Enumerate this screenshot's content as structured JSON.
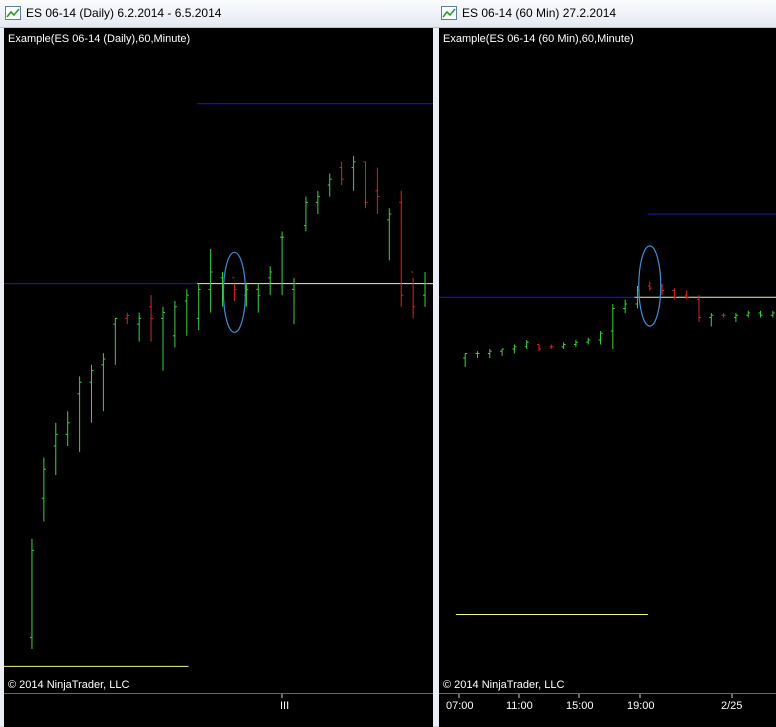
{
  "windows": [
    {
      "id": "daily",
      "title": "ES 06-14 (Daily)  6.2.2014 - 6.5.2014",
      "chart_label": "Example(ES 06-14 (Daily),60,Minute)",
      "copyright": "© 2014 NinjaTrader, LLC",
      "x_axis_labels": [
        "III"
      ]
    },
    {
      "id": "60min",
      "title": "ES 06-14 (60 Min)  27.2.2014",
      "chart_label": "Example(ES 06-14 (60 Min),60,Minute)",
      "copyright": "© 2014 NinjaTrader, LLC",
      "x_axis_labels": [
        "07:00",
        "11:00",
        "15:00",
        "19:00",
        "2/25"
      ]
    }
  ],
  "colors": {
    "up_bar": "#3dd13d",
    "down_bar": "#e02020",
    "level_line_blue": "#1a1acc",
    "level_line_yellow": "#f2f28c",
    "highlight_ellipse": "#3a8fd8",
    "background": "#000000",
    "text": "#ffffff"
  },
  "chart_data": [
    {
      "type": "ohlc",
      "name": "ES 06-14 (Daily)",
      "y_range": [
        0,
        100
      ],
      "bars": [
        {
          "o": 7,
          "h": 24,
          "l": 5,
          "c": 22,
          "dir": "up"
        },
        {
          "o": 31,
          "h": 38,
          "l": 27,
          "c": 36,
          "dir": "up"
        },
        {
          "o": 40,
          "h": 44,
          "l": 35,
          "c": 42,
          "dir": "up"
        },
        {
          "o": 42,
          "h": 46,
          "l": 40,
          "c": 44,
          "dir": "up"
        },
        {
          "o": 49,
          "h": 52,
          "l": 39,
          "c": 51,
          "dir": "up"
        },
        {
          "o": 51,
          "h": 54,
          "l": 44,
          "c": 53,
          "dir": "up"
        },
        {
          "o": 54,
          "h": 56,
          "l": 46,
          "c": 55,
          "dir": "up"
        },
        {
          "o": 61,
          "h": 62,
          "l": 54,
          "c": 62,
          "dir": "up"
        },
        {
          "o": 62,
          "h": 63,
          "l": 61,
          "c": 62.5,
          "dir": "down"
        },
        {
          "o": 61,
          "h": 63,
          "l": 58,
          "c": 62,
          "dir": "up"
        },
        {
          "o": 64,
          "h": 66,
          "l": 58,
          "c": 62,
          "dir": "down"
        },
        {
          "o": 62,
          "h": 64,
          "l": 53,
          "c": 63,
          "dir": "up"
        },
        {
          "o": 59,
          "h": 65,
          "l": 57,
          "c": 64,
          "dir": "up"
        },
        {
          "o": 65,
          "h": 67,
          "l": 59,
          "c": 66,
          "dir": "up"
        },
        {
          "o": 62,
          "h": 68,
          "l": 60,
          "c": 67,
          "dir": "up"
        },
        {
          "o": 67,
          "h": 74,
          "l": 63,
          "c": 70,
          "dir": "up"
        },
        {
          "o": 69,
          "h": 70,
          "l": 64,
          "c": 68,
          "dir": "up"
        },
        {
          "o": 69,
          "h": 68,
          "l": 65,
          "c": 67,
          "dir": "down"
        },
        {
          "o": 66,
          "h": 68,
          "l": 64,
          "c": 67,
          "dir": "up"
        },
        {
          "o": 67,
          "h": 68,
          "l": 63,
          "c": 66,
          "dir": "up"
        },
        {
          "o": 69,
          "h": 71,
          "l": 66,
          "c": 70,
          "dir": "up"
        },
        {
          "o": 76,
          "h": 77,
          "l": 66,
          "c": 76,
          "dir": "up"
        },
        {
          "o": 67,
          "h": 69,
          "l": 61,
          "c": 68,
          "dir": "up"
        },
        {
          "o": 78,
          "h": 83,
          "l": 77,
          "c": 82,
          "dir": "up"
        },
        {
          "o": 82,
          "h": 84,
          "l": 80,
          "c": 83,
          "dir": "up"
        },
        {
          "o": 85,
          "h": 87,
          "l": 83,
          "c": 86,
          "dir": "up"
        },
        {
          "o": 88,
          "h": 89,
          "l": 85,
          "c": 86,
          "dir": "down"
        },
        {
          "o": 88,
          "h": 90,
          "l": 84,
          "c": 89,
          "dir": "up"
        },
        {
          "o": 89,
          "h": 89,
          "l": 81,
          "c": 82,
          "dir": "down"
        },
        {
          "o": 84,
          "h": 88,
          "l": 80,
          "c": 83,
          "dir": "down"
        },
        {
          "o": 79,
          "h": 81,
          "l": 72,
          "c": 80,
          "dir": "up"
        },
        {
          "o": 82,
          "h": 84,
          "l": 64,
          "c": 66,
          "dir": "down"
        },
        {
          "o": 70,
          "h": 69,
          "l": 62,
          "c": 64,
          "dir": "down"
        },
        {
          "o": 66,
          "h": 70,
          "l": 64,
          "c": 68,
          "dir": "up"
        }
      ],
      "levels": [
        {
          "color": "blue",
          "value": 68,
          "from": 0,
          "to": 0.45
        },
        {
          "color": "yellow",
          "value": 68,
          "from": 0.45,
          "to": 1.0
        },
        {
          "color": "blue",
          "value": 99,
          "from": 0.45,
          "to": 1.0
        },
        {
          "color": "yellow",
          "value": 2,
          "from": 0,
          "to": 0.43
        }
      ],
      "highlight": {
        "bar_index": 17
      }
    },
    {
      "type": "ohlc",
      "name": "ES 06-14 (60 Min)",
      "y_range": [
        0,
        100
      ],
      "bars": [
        {
          "o": 60,
          "h": 61,
          "l": 58,
          "c": 61,
          "dir": "up"
        },
        {
          "o": 61,
          "h": 61.5,
          "l": 60,
          "c": 61,
          "dir": "up"
        },
        {
          "o": 61,
          "h": 62,
          "l": 60,
          "c": 61.5,
          "dir": "up"
        },
        {
          "o": 61.5,
          "h": 62,
          "l": 60.5,
          "c": 62,
          "dir": "up"
        },
        {
          "o": 62,
          "h": 63,
          "l": 61,
          "c": 62.5,
          "dir": "up"
        },
        {
          "o": 62.5,
          "h": 64,
          "l": 62,
          "c": 63.5,
          "dir": "up"
        },
        {
          "o": 63,
          "h": 63,
          "l": 61.5,
          "c": 62,
          "dir": "down"
        },
        {
          "o": 62.5,
          "h": 63,
          "l": 62,
          "c": 62.5,
          "dir": "down"
        },
        {
          "o": 62.5,
          "h": 63.5,
          "l": 62,
          "c": 63,
          "dir": "up"
        },
        {
          "o": 63,
          "h": 64,
          "l": 62.5,
          "c": 63.5,
          "dir": "up"
        },
        {
          "o": 63.5,
          "h": 64.5,
          "l": 63,
          "c": 64,
          "dir": "up"
        },
        {
          "o": 64,
          "h": 66,
          "l": 63,
          "c": 65.5,
          "dir": "up"
        },
        {
          "o": 66,
          "h": 72,
          "l": 62,
          "c": 71,
          "dir": "up"
        },
        {
          "o": 71,
          "h": 73,
          "l": 70,
          "c": 72,
          "dir": "up"
        },
        {
          "o": 72,
          "h": 76,
          "l": 71,
          "c": 75,
          "dir": "up"
        },
        {
          "o": 76,
          "h": 77,
          "l": 75,
          "c": 75.5,
          "dir": "down"
        },
        {
          "o": 76,
          "h": 76.5,
          "l": 74,
          "c": 75,
          "dir": "down"
        },
        {
          "o": 75,
          "h": 75.5,
          "l": 73,
          "c": 73.5,
          "dir": "down"
        },
        {
          "o": 74,
          "h": 75,
          "l": 73,
          "c": 73.5,
          "dir": "down"
        },
        {
          "o": 73,
          "h": 74,
          "l": 68,
          "c": 69,
          "dir": "down"
        },
        {
          "o": 69,
          "h": 70,
          "l": 67,
          "c": 69.5,
          "dir": "up"
        },
        {
          "o": 69.5,
          "h": 70,
          "l": 69,
          "c": 69.5,
          "dir": "down"
        },
        {
          "o": 69,
          "h": 70,
          "l": 68,
          "c": 69.5,
          "dir": "up"
        },
        {
          "o": 69.5,
          "h": 70.5,
          "l": 69,
          "c": 70,
          "dir": "up"
        },
        {
          "o": 70,
          "h": 70.5,
          "l": 69,
          "c": 69.5,
          "dir": "up"
        },
        {
          "o": 69.5,
          "h": 70.5,
          "l": 69,
          "c": 70,
          "dir": "up"
        }
      ],
      "levels": [
        {
          "color": "blue",
          "value": 73.5,
          "from": 0,
          "to": 0.58
        },
        {
          "color": "yellow",
          "value": 73.5,
          "from": 0.58,
          "to": 1.0
        },
        {
          "color": "blue",
          "value": 92,
          "from": 0.62,
          "to": 1.0
        },
        {
          "color": "yellow",
          "value": 3,
          "from": 0.05,
          "to": 0.62
        }
      ],
      "highlight": {
        "bar_index": 15
      }
    }
  ]
}
